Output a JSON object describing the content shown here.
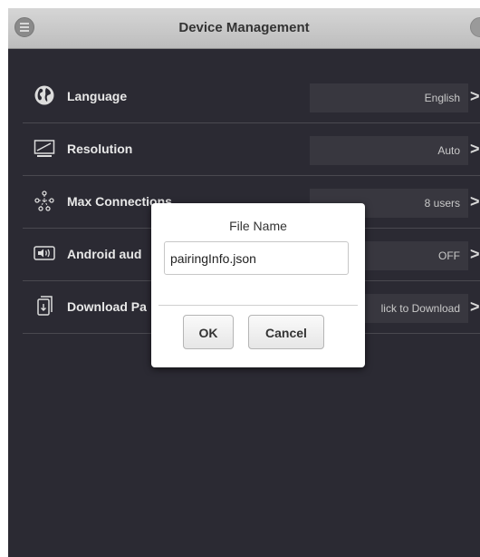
{
  "header": {
    "title": "Device Management",
    "menu_icon": "hamburger-menu-icon"
  },
  "settings": {
    "rows": [
      {
        "id": "language",
        "icon": "globe-icon",
        "label": "Language",
        "value": "English"
      },
      {
        "id": "resolution",
        "icon": "monitor-icon",
        "label": "Resolution",
        "value": "Auto"
      },
      {
        "id": "max-connections",
        "icon": "network-icon",
        "label": "Max Connections",
        "value": "8 users"
      },
      {
        "id": "android-audio",
        "icon": "speaker-icon",
        "label": "Android aud",
        "value": "OFF"
      },
      {
        "id": "download",
        "icon": "download-icon",
        "label": "Download Pa",
        "value": "lick to Download"
      }
    ],
    "chevron": ">"
  },
  "dialog": {
    "title": "File Name",
    "input_value": "pairingInfo.json",
    "ok_label": "OK",
    "cancel_label": "Cancel"
  },
  "colors": {
    "background": "#2b2a33",
    "titlebar": "#cccccc",
    "value_box": "#38373f",
    "text": "#e8e8e8"
  }
}
